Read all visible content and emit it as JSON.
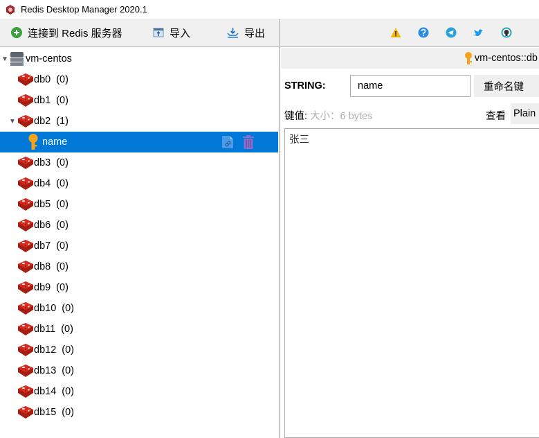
{
  "window": {
    "title": "Redis Desktop Manager 2020.1"
  },
  "toolbar": {
    "connect": "连接到 Redis 服务器",
    "import": "导入",
    "export": "导出"
  },
  "right_toolbar": {
    "icons": [
      "warning-icon",
      "help-icon",
      "telegram-icon",
      "twitter-icon",
      "github-icon"
    ]
  },
  "tree": {
    "connection": "vm-centos",
    "databases": [
      {
        "name": "db0",
        "count": "(0)"
      },
      {
        "name": "db1",
        "count": "(0)"
      },
      {
        "name": "db2",
        "count": "(1)",
        "expanded": true
      },
      {
        "name": "db3",
        "count": "(0)"
      },
      {
        "name": "db4",
        "count": "(0)"
      },
      {
        "name": "db5",
        "count": "(0)"
      },
      {
        "name": "db6",
        "count": "(0)"
      },
      {
        "name": "db7",
        "count": "(0)"
      },
      {
        "name": "db8",
        "count": "(0)"
      },
      {
        "name": "db9",
        "count": "(0)"
      },
      {
        "name": "db10",
        "count": "(0)"
      },
      {
        "name": "db11",
        "count": "(0)"
      },
      {
        "name": "db12",
        "count": "(0)"
      },
      {
        "name": "db13",
        "count": "(0)"
      },
      {
        "name": "db14",
        "count": "(0)"
      },
      {
        "name": "db15",
        "count": "(0)"
      }
    ],
    "selected_key": "name"
  },
  "tab": {
    "title": "vm-centos::db"
  },
  "key_view": {
    "type_label": "STRING:",
    "key_name": "name",
    "rename_button": "重命名键",
    "value_label": "键值:",
    "size_label": "大小：6 bytes",
    "view_label": "查看",
    "view_mode": "Plain",
    "value": "张三"
  },
  "colors": {
    "selection": "#0078d7",
    "redis_red": "#d82c20"
  }
}
